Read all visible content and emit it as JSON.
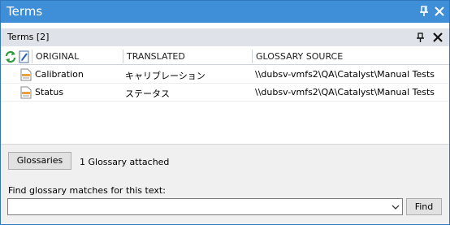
{
  "window": {
    "title": "Terms"
  },
  "panel": {
    "label": "Terms [2]"
  },
  "columns": {
    "original": "ORIGINAL",
    "translated": "TRANSLATED",
    "source": "GLOSSARY SOURCE"
  },
  "rows": [
    {
      "original": "Calibration",
      "translated": "キャリブレーション",
      "source": "\\\\dubsv-vmfs2\\QA\\Catalyst\\Manual Tests"
    },
    {
      "original": "Status",
      "translated": "ステータス",
      "source": "\\\\dubsv-vmfs2\\QA\\Catalyst\\Manual Tests"
    }
  ],
  "bottom": {
    "glossaries_button": "Glossaries",
    "status_text": "1 Glossary attached",
    "find_label": "Find glossary matches for this text:",
    "find_value": "",
    "find_button": "Find"
  },
  "icons": {
    "title_pin": "pin-icon",
    "title_close": "close-icon",
    "panel_pin": "pin-icon",
    "panel_close": "close-icon",
    "refresh": "refresh-icon",
    "edit": "edit-document-icon",
    "term": "term-document-icon",
    "dropdown": "chevron-down-icon"
  },
  "colors": {
    "titlebar": "#3f8fd8",
    "subheader": "#dfe2e8",
    "refresh_green": "#2e9a3e"
  }
}
